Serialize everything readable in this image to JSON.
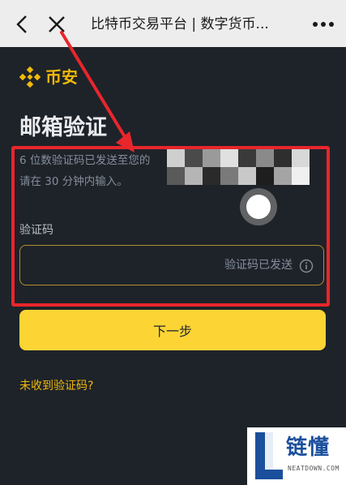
{
  "topbar": {
    "title": "比特币交易平台 | 数字货币..."
  },
  "logo": {
    "brand": "币安"
  },
  "page": {
    "title": "邮箱验证",
    "desc_line1": "6 位数验证码已发送至您的",
    "desc_line2": "请在 30 分钟内输入。"
  },
  "form": {
    "code_label": "验证码",
    "code_status": "验证码已发送"
  },
  "actions": {
    "next_label": "下一步",
    "resend_label": "未收到验证码?"
  },
  "watermark": {
    "text": "链懂",
    "sub": "NEATDOWN.COM"
  },
  "colors": {
    "background": "#1e2329",
    "accent": "#f0b90b",
    "button": "#fcd535",
    "annotation": "#e8262c"
  },
  "icons": [
    "back-arrow-icon",
    "close-icon",
    "more-icon",
    "binance-logo-icon",
    "info-icon"
  ]
}
